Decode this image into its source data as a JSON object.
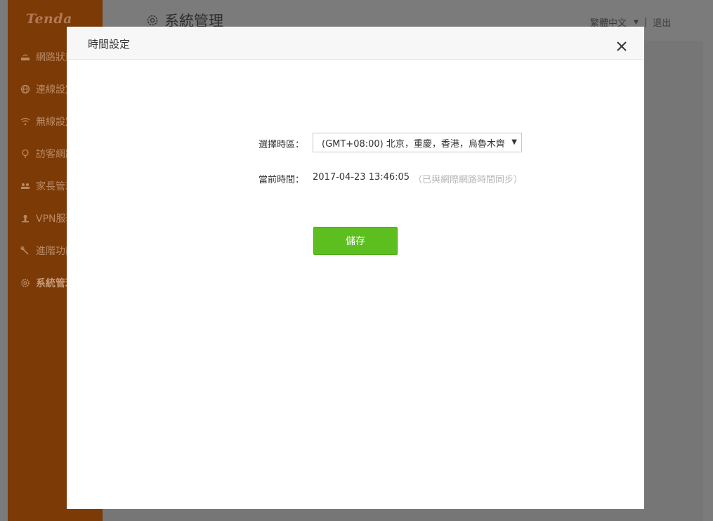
{
  "app": {
    "logo": "Tenda",
    "page_title": "系統管理",
    "language": "繁體中文",
    "logout": "退出",
    "separator": "|"
  },
  "sidebar": {
    "items": [
      {
        "label": "網路狀態",
        "icon": "router-icon"
      },
      {
        "label": "連線設定",
        "icon": "globe-icon"
      },
      {
        "label": "無線設定",
        "icon": "wifi-icon"
      },
      {
        "label": "訪客網路",
        "icon": "guest-icon"
      },
      {
        "label": "家長管理",
        "icon": "family-icon"
      },
      {
        "label": "VPN服務",
        "icon": "vpn-icon"
      },
      {
        "label": "進階功能",
        "icon": "wrench-icon"
      },
      {
        "label": "系統管理",
        "icon": "gear-icon",
        "active": true
      }
    ]
  },
  "modal": {
    "title": "時間設定",
    "timezone_label": "選擇時區：",
    "timezone_value": "(GMT+08:00) 北京，重慶，香港，烏魯木齊",
    "current_time_label": "當前時間：",
    "current_time_value": "2017-04-23 13:46:05",
    "sync_note": "（已與網際網路時間同步）",
    "save_label": "儲存"
  },
  "colors": {
    "sidebar": "#7c3a06",
    "save_button": "#5dbf1f",
    "overlay": "#7b7b7b"
  }
}
